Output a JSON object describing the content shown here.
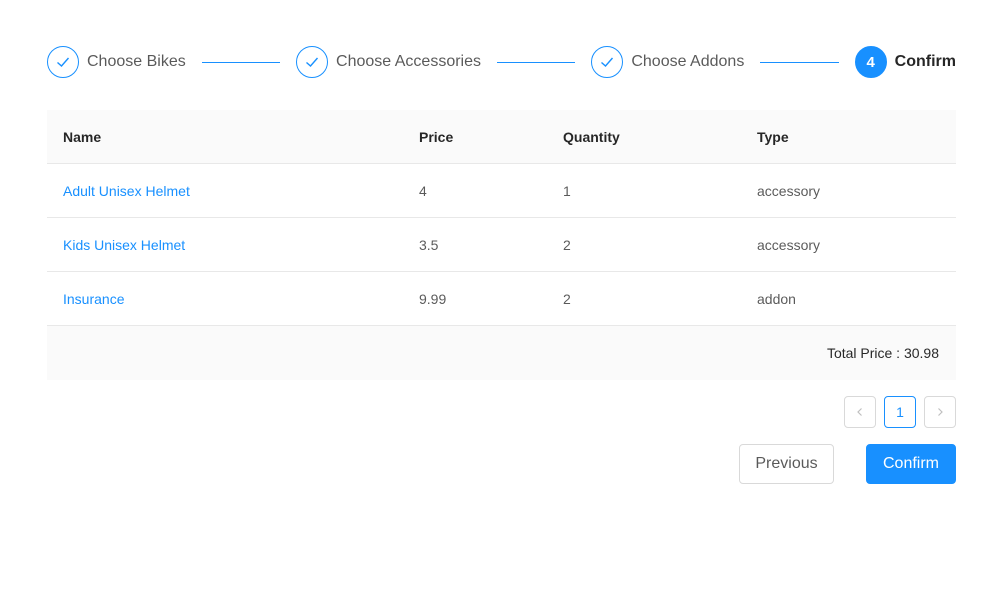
{
  "steps": [
    {
      "label": "Choose Bikes",
      "status": "finished",
      "icon": "check-icon"
    },
    {
      "label": "Choose Accessories",
      "status": "finished",
      "icon": "check-icon"
    },
    {
      "label": "Choose Addons",
      "status": "finished",
      "icon": "check-icon"
    },
    {
      "label": "Confirm",
      "status": "active",
      "number": "4"
    }
  ],
  "table": {
    "headers": {
      "name": "Name",
      "price": "Price",
      "quantity": "Quantity",
      "type": "Type"
    },
    "rows": [
      {
        "name": "Adult Unisex Helmet",
        "price": "4",
        "quantity": "1",
        "type": "accessory"
      },
      {
        "name": "Kids Unisex Helmet",
        "price": "3.5",
        "quantity": "2",
        "type": "accessory"
      },
      {
        "name": "Insurance",
        "price": "9.99",
        "quantity": "2",
        "type": "addon"
      }
    ],
    "footer": "Total Price : 30.98"
  },
  "pagination": {
    "current": "1",
    "prev_icon": "chevron-left-icon",
    "next_icon": "chevron-right-icon"
  },
  "buttons": {
    "previous": "Previous",
    "confirm": "Confirm"
  },
  "colors": {
    "primary": "#1890ff",
    "border": "#e8e8e8",
    "header_bg": "#fafafa"
  }
}
